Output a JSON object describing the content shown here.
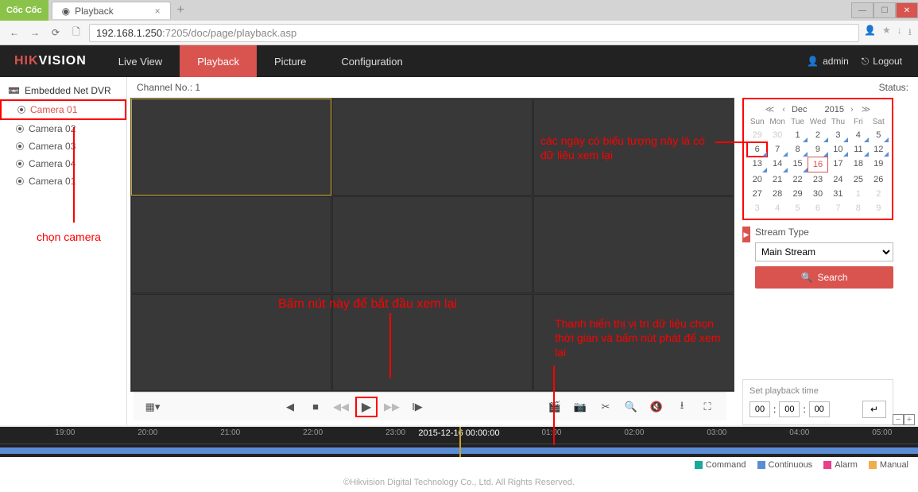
{
  "browser": {
    "brand": "Cốc Cốc",
    "tab_title": "Playback",
    "url_host": "192.168.1.250",
    "url_path": ":7205/doc/page/playback.asp"
  },
  "header": {
    "logo1": "HIK",
    "logo2": "VISION",
    "nav": [
      "Live View",
      "Playback",
      "Picture",
      "Configuration"
    ],
    "active": "Playback",
    "user": "admin",
    "logout": "Logout"
  },
  "sidebar": {
    "root": "Embedded Net DVR",
    "cameras": [
      "Camera 01",
      "Camera 02",
      "Camera 03",
      "Camera 04",
      "Camera 01"
    ],
    "selected": 0
  },
  "status": {
    "channel_label": "Channel No.: 1",
    "status_label": "Status:"
  },
  "calendar": {
    "month": "Dec",
    "year": "2015",
    "dow": [
      "Sun",
      "Mon",
      "Tue",
      "Wed",
      "Thu",
      "Fri",
      "Sat"
    ],
    "rows": [
      [
        {
          "n": 29,
          "o": true
        },
        {
          "n": 30,
          "o": true
        },
        {
          "n": 1,
          "d": true
        },
        {
          "n": 2,
          "d": true
        },
        {
          "n": 3,
          "d": true
        },
        {
          "n": 4,
          "d": true
        },
        {
          "n": 5,
          "d": true
        }
      ],
      [
        {
          "n": 6,
          "d": true,
          "box": true
        },
        {
          "n": 7,
          "d": true
        },
        {
          "n": 8,
          "d": true
        },
        {
          "n": 9,
          "d": true
        },
        {
          "n": 10,
          "d": true
        },
        {
          "n": 11,
          "d": true
        },
        {
          "n": 12,
          "d": true
        }
      ],
      [
        {
          "n": 13,
          "d": true
        },
        {
          "n": 14,
          "d": true
        },
        {
          "n": 15,
          "d": true
        },
        {
          "n": 16,
          "today": true
        },
        {
          "n": 17
        },
        {
          "n": 18
        },
        {
          "n": 19
        }
      ],
      [
        {
          "n": 20
        },
        {
          "n": 21
        },
        {
          "n": 22
        },
        {
          "n": 23
        },
        {
          "n": 24
        },
        {
          "n": 25
        },
        {
          "n": 26
        }
      ],
      [
        {
          "n": 27
        },
        {
          "n": 28
        },
        {
          "n": 29
        },
        {
          "n": 30
        },
        {
          "n": 31
        },
        {
          "n": 1,
          "o": true
        },
        {
          "n": 2,
          "o": true
        }
      ],
      [
        {
          "n": 3,
          "o": true
        },
        {
          "n": 4,
          "o": true
        },
        {
          "n": 5,
          "o": true
        },
        {
          "n": 6,
          "o": true
        },
        {
          "n": 7,
          "o": true
        },
        {
          "n": 8,
          "o": true
        },
        {
          "n": 9,
          "o": true
        }
      ]
    ]
  },
  "stream": {
    "label": "Stream Type",
    "value": "Main Stream",
    "search": "Search"
  },
  "settime": {
    "label": "Set playback time",
    "h": "00",
    "m": "00",
    "s": "00"
  },
  "timeline": {
    "center": "2015-12-16 00:00:00",
    "ticks": [
      "19:00",
      "20:00",
      "21:00",
      "22:00",
      "23:00",
      "",
      "01:00",
      "02:00",
      "03:00",
      "04:00",
      "05:00"
    ],
    "tick_pos": [
      6,
      15,
      24,
      33,
      42,
      50,
      59,
      68,
      77,
      86,
      95
    ]
  },
  "legend": {
    "items": [
      {
        "label": "Command",
        "color": "#1aa89c"
      },
      {
        "label": "Continuous",
        "color": "#5b8dd6"
      },
      {
        "label": "Alarm",
        "color": "#e83e8c"
      },
      {
        "label": "Manual",
        "color": "#f0ad4e"
      }
    ]
  },
  "footer": "©Hikvision Digital Technology Co., Ltd. All Rights Reserved.",
  "annotations": {
    "a1": "chọn camera",
    "a2": "các ngày có biểu tượng này là có dữ liệu xem lại",
    "a3": "Bấm nút này để bắt đầu xem lại",
    "a4": "Thanh hiển thị vị trí dữ liệu chọn thời gian và bấm nút phát để xem lại"
  }
}
